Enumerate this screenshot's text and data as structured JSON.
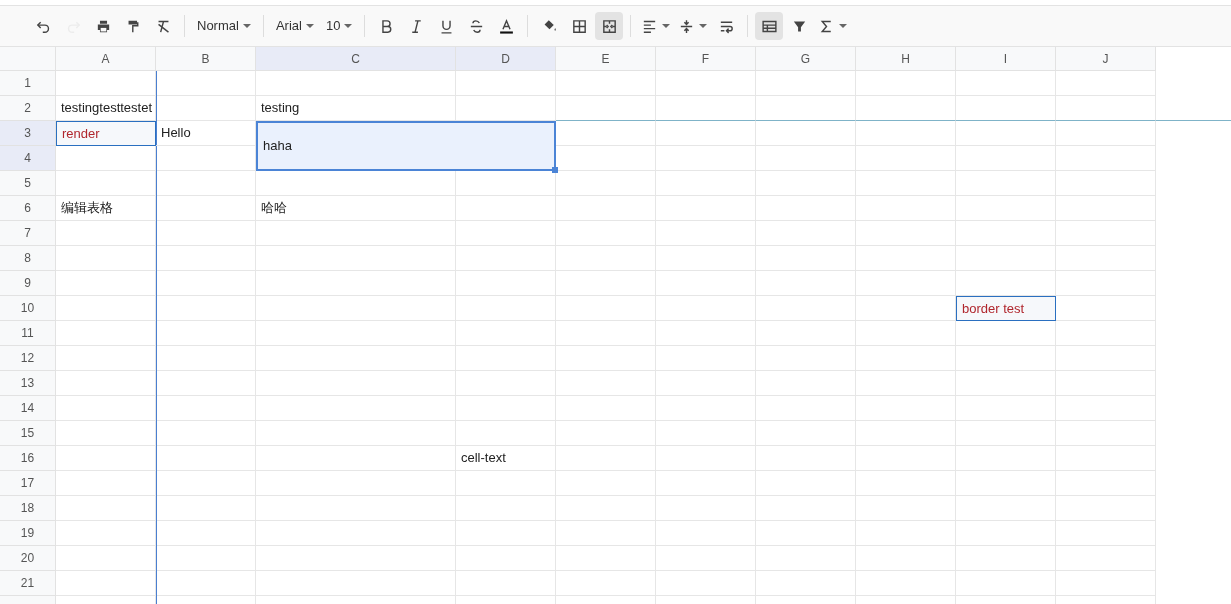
{
  "toolbar": [
    {
      "kind": "icon",
      "disabled": false,
      "active": false,
      "dropdown": false
    },
    {
      "kind": "icon",
      "disabled": true,
      "active": false,
      "dropdown": false
    },
    {
      "kind": "icon",
      "disabled": false,
      "active": false,
      "dropdown": false
    },
    {
      "kind": "icon",
      "disabled": false,
      "active": false,
      "dropdown": false
    },
    {
      "kind": "icon",
      "disabled": false,
      "active": false,
      "dropdown": false
    },
    {
      "kind": "separator"
    },
    {
      "kind": "select",
      "value": "Normal"
    },
    {
      "kind": "separator"
    },
    {
      "kind": "select",
      "value": "Arial"
    },
    {
      "kind": "select",
      "value": "10"
    },
    {
      "kind": "separator"
    },
    {
      "kind": "icon",
      "disabled": false,
      "active": false,
      "dropdown": false
    },
    {
      "kind": "icon",
      "disabled": false,
      "active": false,
      "dropdown": false
    },
    {
      "kind": "icon",
      "disabled": false,
      "active": false,
      "dropdown": false
    },
    {
      "kind": "icon",
      "disabled": false,
      "active": false,
      "dropdown": false
    },
    {
      "kind": "icon",
      "disabled": false,
      "active": false,
      "dropdown": false
    },
    {
      "kind": "separator"
    },
    {
      "kind": "icon",
      "disabled": false,
      "active": false,
      "dropdown": false
    },
    {
      "kind": "icon",
      "disabled": false,
      "active": false,
      "dropdown": false
    },
    {
      "kind": "icon",
      "disabled": false,
      "active": true,
      "dropdown": false
    },
    {
      "kind": "separator"
    },
    {
      "kind": "icon",
      "disabled": false,
      "active": false,
      "dropdown": true
    },
    {
      "kind": "icon",
      "disabled": false,
      "active": false,
      "dropdown": true
    },
    {
      "kind": "icon",
      "disabled": false,
      "active": false,
      "dropdown": false
    },
    {
      "kind": "separator"
    },
    {
      "kind": "icon",
      "disabled": false,
      "active": true,
      "dropdown": false
    },
    {
      "kind": "icon",
      "disabled": false,
      "active": false,
      "dropdown": false
    },
    {
      "kind": "icon",
      "disabled": false,
      "active": false,
      "dropdown": true
    }
  ],
  "columns": [
    {
      "label": "A",
      "selected": false
    },
    {
      "label": "B",
      "selected": false
    },
    {
      "label": "C",
      "selected": true
    },
    {
      "label": "D",
      "selected": true
    },
    {
      "label": "E",
      "selected": false
    },
    {
      "label": "F",
      "selected": false
    },
    {
      "label": "G",
      "selected": false
    },
    {
      "label": "H",
      "selected": false
    },
    {
      "label": "I",
      "selected": false
    },
    {
      "label": "J",
      "selected": false
    }
  ],
  "rows": [
    {
      "label": "1",
      "selected": false
    },
    {
      "label": "2",
      "selected": false,
      "cells": [
        {
          "text": "testingtesttestet",
          "kind": "text"
        },
        null,
        {
          "text": "testing",
          "kind": "text"
        }
      ]
    },
    {
      "label": "3",
      "selected": true,
      "cells": [
        {
          "text": "render",
          "kind": "bordered",
          "color": "#b0262d"
        },
        {
          "text": "Hello",
          "kind": "text"
        },
        {
          "text": "haha",
          "kind": "merged",
          "selected": true
        }
      ]
    },
    {
      "label": "4",
      "selected": true
    },
    {
      "label": "5",
      "selected": false
    },
    {
      "label": "6",
      "selected": false,
      "cells": [
        {
          "text": "编辑表格",
          "kind": "text"
        },
        null,
        {
          "text": "哈哈",
          "kind": "text"
        }
      ]
    },
    {
      "label": "7",
      "selected": false
    },
    {
      "label": "8",
      "selected": false
    },
    {
      "label": "9",
      "selected": false
    },
    {
      "label": "10",
      "selected": false,
      "cells": [
        null,
        null,
        null,
        null,
        null,
        null,
        null,
        null,
        {
          "text": "border test",
          "kind": "bordered",
          "color": "#b0262d"
        }
      ]
    },
    {
      "label": "11",
      "selected": false
    },
    {
      "label": "12",
      "selected": false
    },
    {
      "label": "13",
      "selected": false
    },
    {
      "label": "14",
      "selected": false
    },
    {
      "label": "15",
      "selected": false
    },
    {
      "label": "16",
      "selected": false,
      "cells": [
        null,
        null,
        null,
        {
          "text": "cell-text",
          "kind": "text"
        }
      ]
    },
    {
      "label": "17",
      "selected": false
    },
    {
      "label": "18",
      "selected": false
    },
    {
      "label": "19",
      "selected": false
    },
    {
      "label": "20",
      "selected": false
    },
    {
      "label": "21",
      "selected": false
    }
  ]
}
